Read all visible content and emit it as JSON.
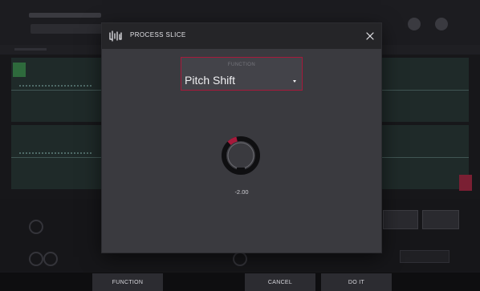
{
  "dialog": {
    "title": "PROCESS SLICE",
    "icon": "process-slice-icon",
    "close_icon": "close-icon"
  },
  "function_field": {
    "label": "FUNCTION",
    "value": "Pitch Shift",
    "caret_icon": "caret-down-icon"
  },
  "knob": {
    "value": "-2.00",
    "level_fraction": 0.45
  },
  "toolbar": {
    "function_label": "FUNCTION",
    "cancel_label": "CANCEL",
    "do_it_label": "DO IT"
  },
  "colors": {
    "accent": "#a7193b",
    "dialog_bg": "#3a3a3f",
    "header_bg": "#252528",
    "knob_track": "#0f0f11",
    "knob_ring": "#6d6d73"
  }
}
